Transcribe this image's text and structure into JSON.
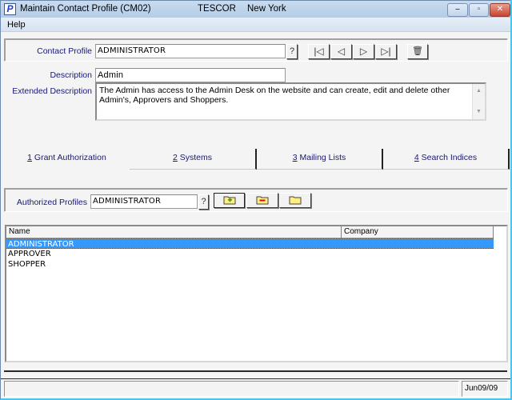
{
  "window": {
    "title": "Maintain Contact Profile (CM02)",
    "company": "TESCOR",
    "location": "New York",
    "app_icon_letter": "P",
    "controls": {
      "minimize": "–",
      "maximize": "▫",
      "close": "✕"
    }
  },
  "menu": {
    "help": "Help"
  },
  "header": {
    "contact_profile_label": "Contact Profile",
    "contact_profile_value": "ADMINISTRATOR",
    "lookup_label": "?",
    "nav": {
      "first": "|◁",
      "prev": "◁",
      "next": "▷",
      "last": "▷|"
    },
    "delete_icon": "🗑"
  },
  "details": {
    "description_label": "Description",
    "description_value": "Admin",
    "extended_label": "Extended Description",
    "extended_value": "The Admin has access to the Admin Desk on the website and can create, edit and delete other Admin's, Approvers and Shoppers."
  },
  "tabs": [
    {
      "key": "1",
      "label": " Grant Authorization",
      "active": true
    },
    {
      "key": "2",
      "label": " Systems",
      "active": false
    },
    {
      "key": "3",
      "label": " Mailing Lists",
      "active": false
    },
    {
      "key": "4",
      "label": " Search Indices",
      "active": false
    }
  ],
  "authorized": {
    "label": "Authorized Profiles",
    "value": "ADMINISTRATOR",
    "lookup_label": "?"
  },
  "list": {
    "columns": [
      "Name",
      "Company"
    ],
    "rows": [
      {
        "name": "ADMINISTRATOR",
        "company": "",
        "selected": true
      },
      {
        "name": "APPROVER",
        "company": "",
        "selected": false
      },
      {
        "name": "SHOPPER",
        "company": "",
        "selected": false
      }
    ]
  },
  "statusbar": {
    "message": "",
    "date": "Jun09/09"
  },
  "colors": {
    "selection": "#3399ff",
    "label": "#17177a"
  }
}
